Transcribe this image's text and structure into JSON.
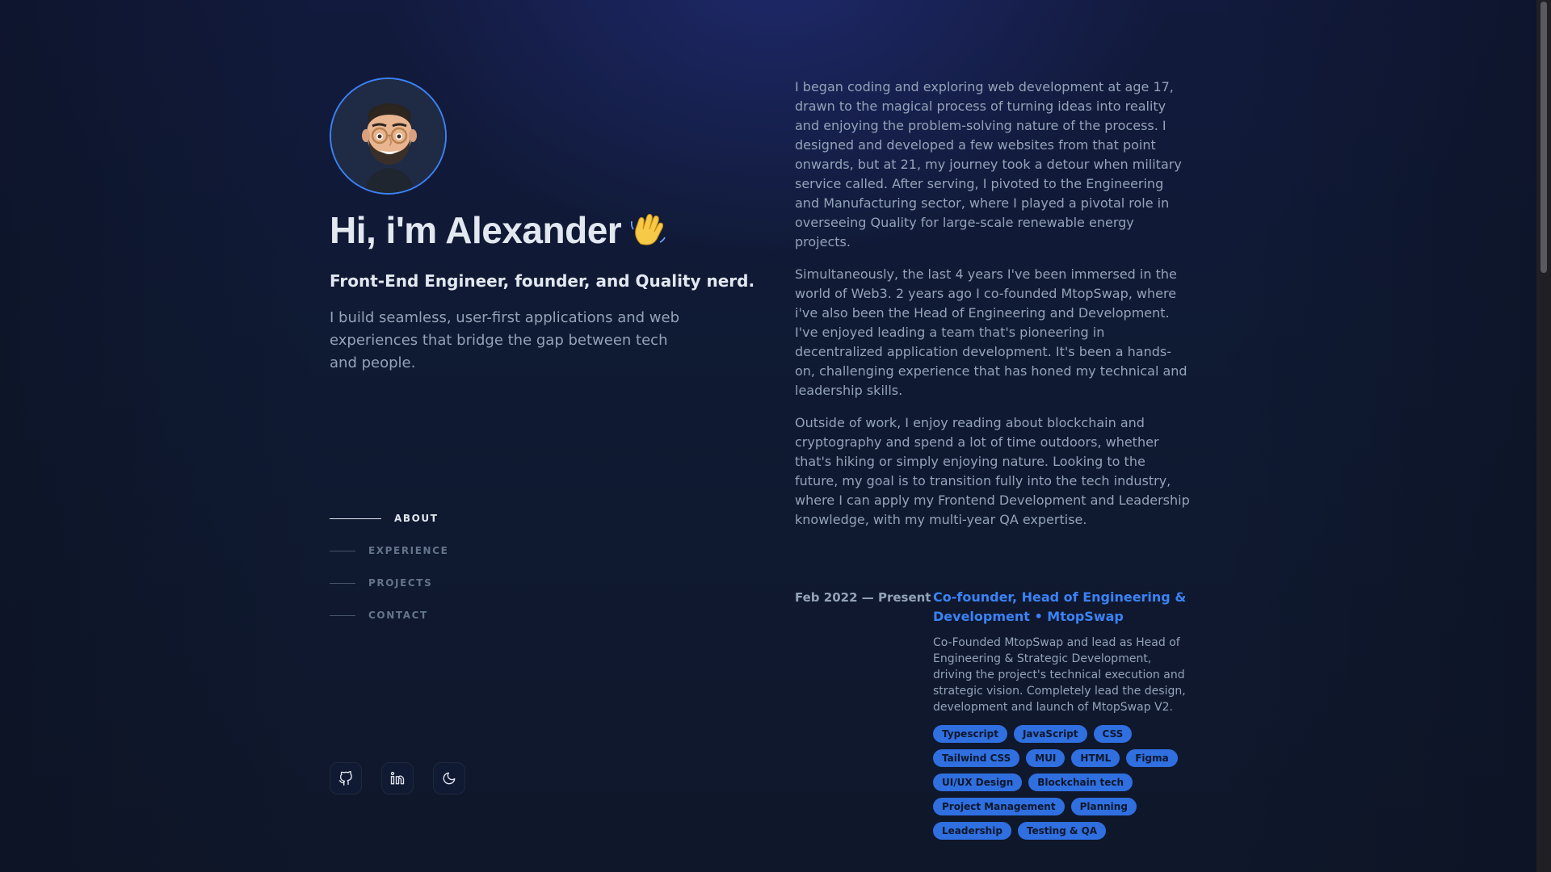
{
  "hero": {
    "name": "Hi, i'm Alexander",
    "tagline": "Front-End Engineer, founder, and Quality nerd.",
    "intro": "I build seamless, user-first applications and web experiences that bridge the gap between tech and people."
  },
  "nav": {
    "items": [
      {
        "label": "ABOUT",
        "active": true
      },
      {
        "label": "EXPERIENCE",
        "active": false
      },
      {
        "label": "PROJECTS",
        "active": false
      },
      {
        "label": "CONTACT",
        "active": false
      }
    ]
  },
  "socials": [
    "github-icon",
    "linkedin-icon",
    "moon-icon"
  ],
  "about": {
    "paragraphs": [
      "I began coding and exploring web development at age 17, drawn to the magical process of turning ideas into reality and enjoying the problem-solving nature of the process. I designed and developed a few websites from that point onwards, but at 21, my journey took a detour when military service called. After serving, I pivoted to the Engineering and Manufacturing sector, where I played a pivotal role in overseeing Quality for large-scale renewable energy projects.",
      "Simultaneously, the last 4 years I've been immersed in the world of Web3. 2 years ago I co-founded MtopSwap, where i've also been the Head of Engineering and Development. I've enjoyed leading a team that's pioneering in decentralized application development. It's been a hands-on, challenging experience that has honed my technical and leadership skills.",
      "Outside of work, I enjoy reading about blockchain and cryptography and spend a lot of time outdoors, whether that's hiking or simply enjoying nature. Looking to the future, my goal is to transition fully into the tech industry, where I can apply my Frontend Development and Leadership knowledge, with my multi-year QA expertise."
    ]
  },
  "experience": {
    "date": "Feb 2022 — Present",
    "title": "Co-founder, Head of Engineering & Development • MtopSwap",
    "description": "Co-Founded MtopSwap and lead as Head of Engineering & Strategic Development, driving the project's technical execution and strategic vision. Completely lead the design, development and launch of MtopSwap V2.",
    "tags": [
      "Typescript",
      "JavaScript",
      "CSS",
      "Tailwind CSS",
      "MUI",
      "HTML",
      "Figma",
      "UI/UX Design",
      "Blockchain tech",
      "Project Management",
      "Planning",
      "Leadership",
      "Testing & QA"
    ]
  },
  "colors": {
    "accent": "#3b82f6",
    "background": "#0f172a",
    "text": "#e2e8f0",
    "muted": "#94a3b8"
  }
}
